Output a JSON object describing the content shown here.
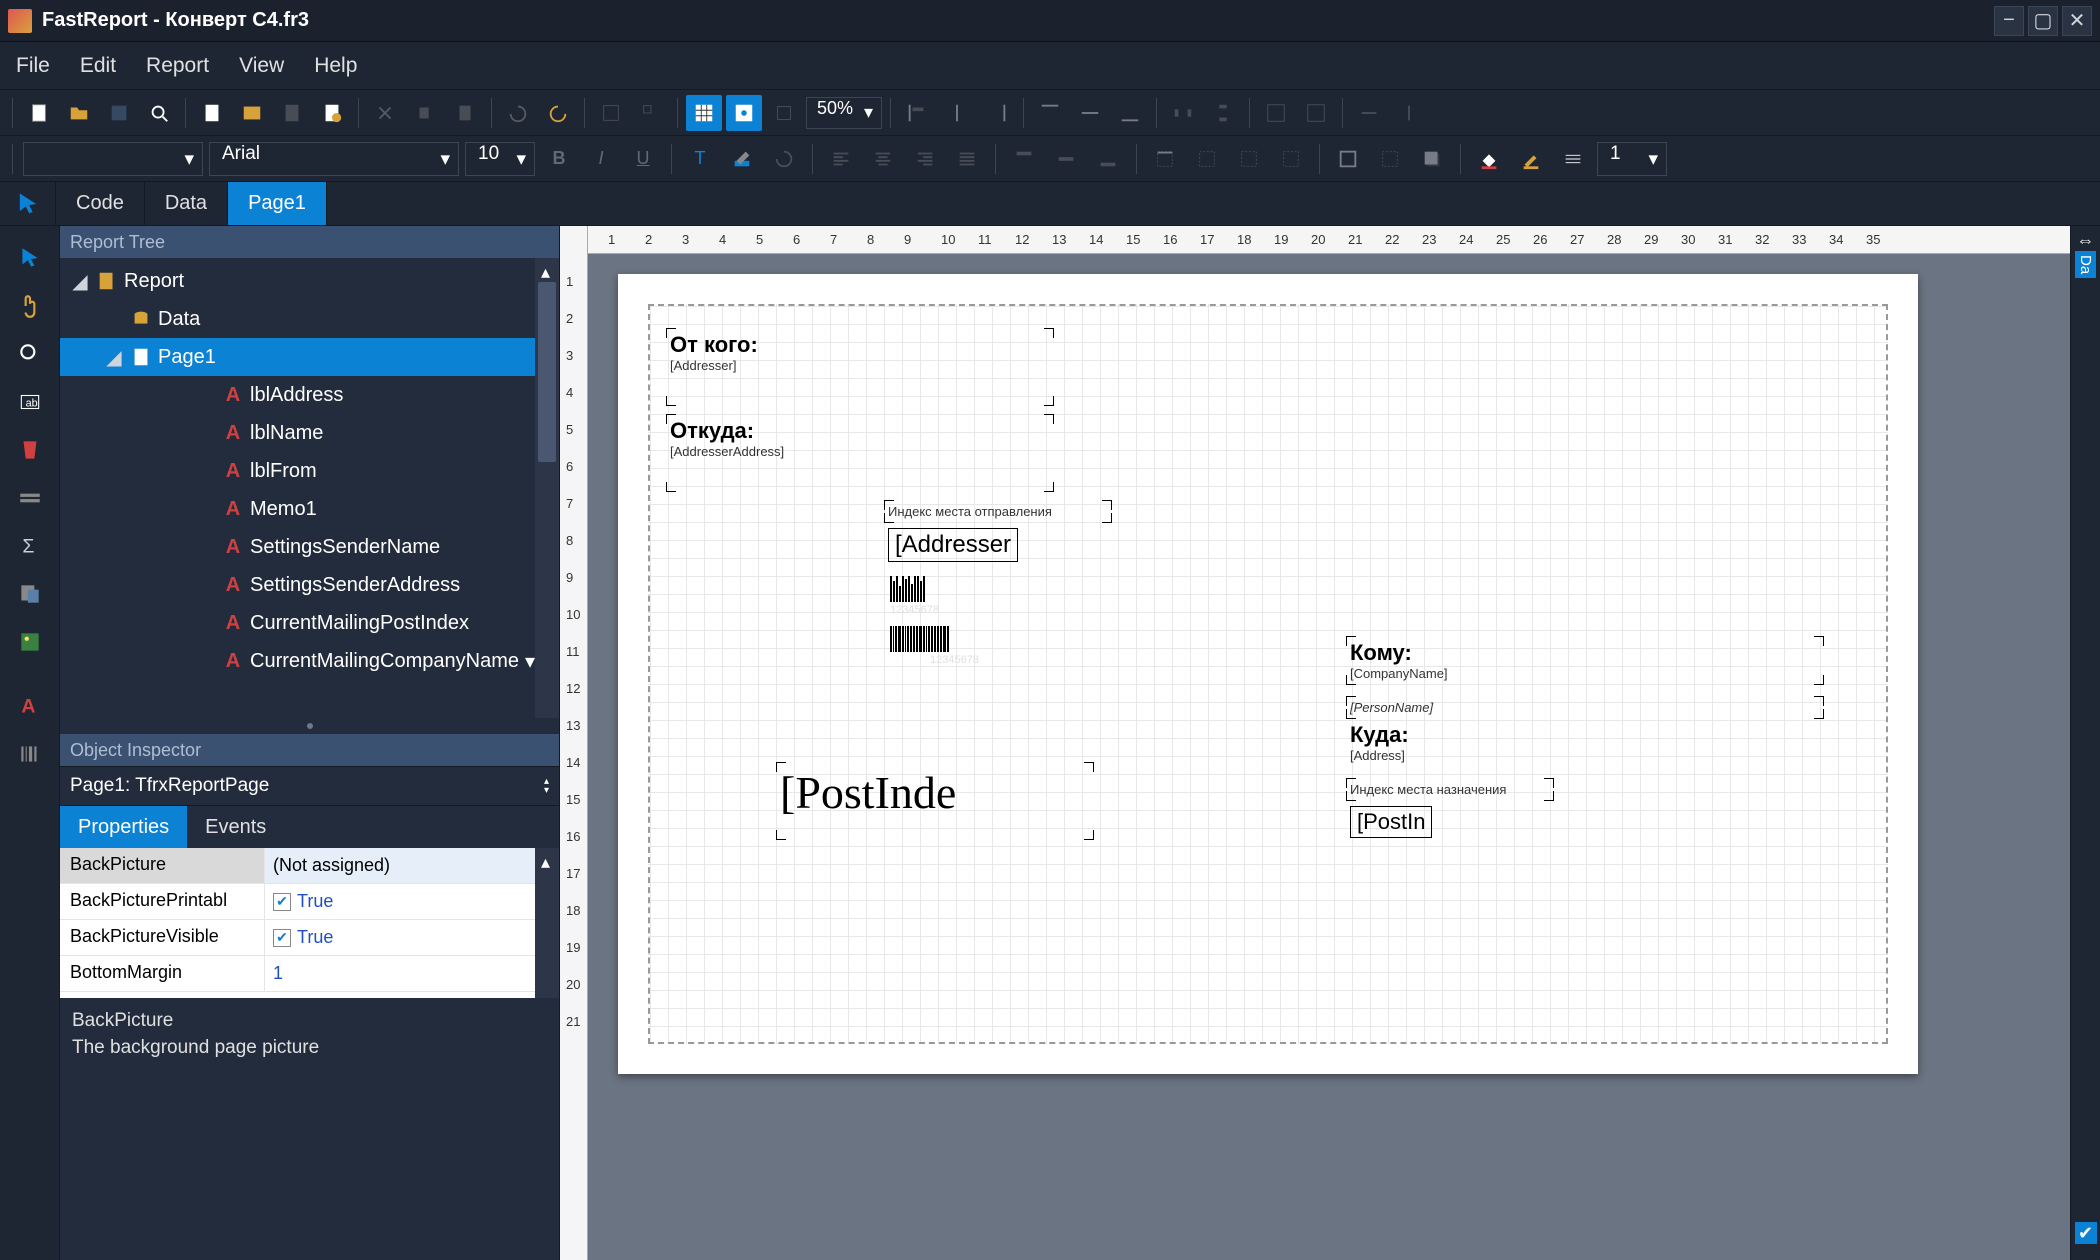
{
  "title": "FastReport - Конверт C4.fr3",
  "menu": [
    "File",
    "Edit",
    "Report",
    "View",
    "Help"
  ],
  "zoom": "50%",
  "font": {
    "name": "Arial",
    "size": "10",
    "style_combo": "",
    "frame_weight": "1"
  },
  "tabs": [
    "Code",
    "Data",
    "Page1"
  ],
  "active_tab": "Page1",
  "tree_title": "Report Tree",
  "tree": {
    "root": "Report",
    "nodes": [
      {
        "label": "Data",
        "icon": "data"
      },
      {
        "label": "Page1",
        "icon": "page",
        "selected": true,
        "children": [
          "lblAddress",
          "lblName",
          "lblFrom",
          "Memo1",
          "SettingsSenderName",
          "SettingsSenderAddress",
          "CurrentMailingPostIndex",
          "CurrentMailingCompanyName"
        ]
      }
    ]
  },
  "inspector_title": "Object Inspector",
  "inspector_object": "Page1: TfrxReportPage",
  "inspector_tabs": [
    "Properties",
    "Events"
  ],
  "properties": [
    {
      "name": "BackPicture",
      "value": "(Not assigned)",
      "selected": true
    },
    {
      "name": "BackPicturePrintabl",
      "value": "True",
      "checkbox": true
    },
    {
      "name": "BackPictureVisible",
      "value": "True",
      "checkbox": true
    },
    {
      "name": "BottomMargin",
      "value": "1"
    }
  ],
  "prop_help": {
    "title": "BackPicture",
    "desc": "The background page picture"
  },
  "right_tab": "Da",
  "ruler_h": [
    1,
    2,
    3,
    4,
    5,
    6,
    7,
    8,
    9,
    10,
    11,
    12,
    13,
    14,
    15,
    16,
    17,
    18,
    19,
    20,
    21,
    22,
    23,
    24,
    25,
    26,
    27,
    28,
    29,
    30,
    31,
    32,
    33,
    34,
    35
  ],
  "ruler_v": [
    1,
    2,
    3,
    4,
    5,
    6,
    7,
    8,
    9,
    10,
    11,
    12,
    13,
    14,
    15,
    16,
    17,
    18,
    19,
    20,
    21
  ],
  "page_items": {
    "lblFrom": "От кого:",
    "addresser": "[Addresser]",
    "lblWhere": "Откуда:",
    "addresserAddr": "[AddresserAddress]",
    "idxSend": "Индекс места отправления",
    "addresserBox": "[Addresser",
    "barcode_num": "12345678",
    "postIndex": "[PostInde",
    "lblTo": "Кому:",
    "company": "[CompanyName]",
    "person": "[PersonName]",
    "lblDest": "Куда:",
    "address": "[Address]",
    "idxDest": "Индекс места назначения",
    "postIn": "[PostIn"
  }
}
